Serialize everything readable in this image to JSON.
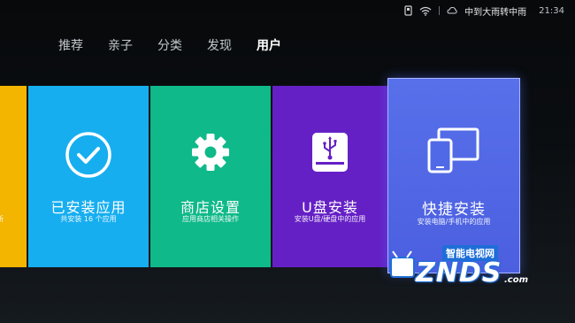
{
  "status_bar": {
    "icons": [
      "usb-drive-icon",
      "wifi-icon",
      "weather-icon"
    ],
    "weather": "中到大雨转中雨",
    "time": "21:34"
  },
  "nav": {
    "tabs": [
      "推荐",
      "亲子",
      "分类",
      "发现",
      "用户"
    ],
    "active_tab": "用户"
  },
  "tiles": [
    {
      "title": "",
      "subtitle": "新",
      "icon": "none",
      "color": "#f4b500"
    },
    {
      "title": "已安装应用",
      "subtitle": "共安装 16 个应用",
      "icon": "check-circle-icon",
      "color": "#17aef0"
    },
    {
      "title": "商店设置",
      "subtitle": "应用商店相关操作",
      "icon": "gear-icon",
      "color": "#0fb989"
    },
    {
      "title": "U盘安装",
      "subtitle": "安装U盘/硬盘中的应用",
      "icon": "usb-drive-icon",
      "color": "#6520c5"
    },
    {
      "title": "快捷安装",
      "subtitle": "安装电脑/手机中的应用",
      "icon": "devices-icon",
      "color": "#5069e6"
    }
  ],
  "watermark": {
    "cn": "智能电视网",
    "en": "ZNDS",
    "domain": ".com"
  }
}
